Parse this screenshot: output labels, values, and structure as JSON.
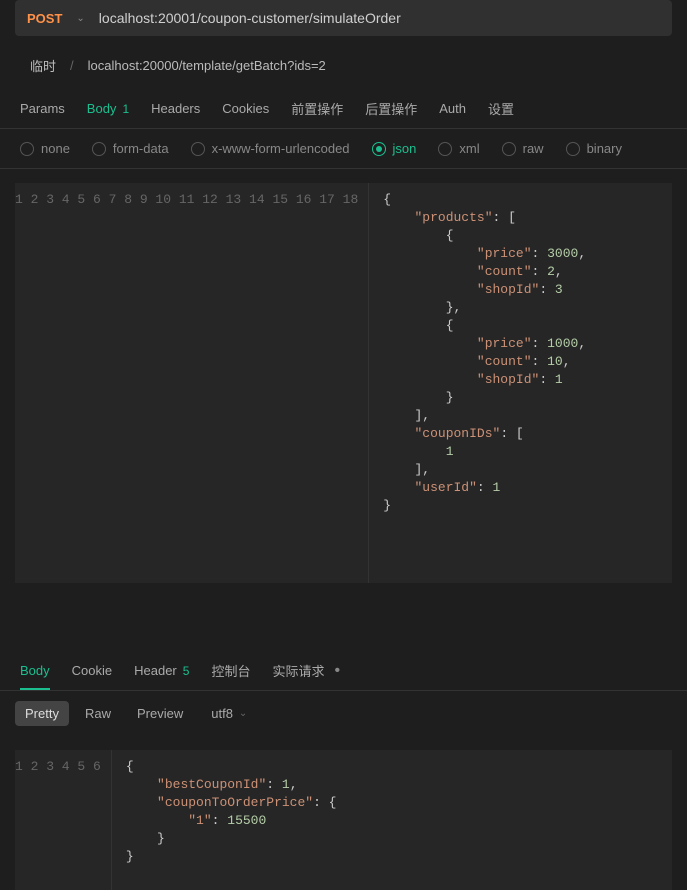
{
  "url_bar": {
    "method": "POST",
    "url": "localhost:20001/coupon-customer/simulateOrder"
  },
  "breadcrumb": {
    "folder": "临时",
    "path": "localhost:20000/template/getBatch?ids=2"
  },
  "request_tabs": {
    "params": "Params",
    "body": "Body",
    "body_count": "1",
    "headers": "Headers",
    "cookies": "Cookies",
    "pre": "前置操作",
    "post": "后置操作",
    "auth": "Auth",
    "settings": "设置"
  },
  "body_types": {
    "none": "none",
    "form_data": "form-data",
    "urlencoded": "x-www-form-urlencoded",
    "json": "json",
    "xml": "xml",
    "raw": "raw",
    "binary": "binary"
  },
  "request_code": {
    "line_count": 18,
    "html": "<span class='p'>{</span>\n    <span class='k'>\"products\"</span><span class='p'>: [</span>\n        <span class='p'>{</span>\n            <span class='k'>\"price\"</span><span class='p'>: </span><span class='n'>3000</span><span class='p'>,</span>\n            <span class='k'>\"count\"</span><span class='p'>: </span><span class='n'>2</span><span class='p'>,</span>\n            <span class='k'>\"shopId\"</span><span class='p'>: </span><span class='n'>3</span>\n        <span class='p'>},</span>\n        <span class='p'>{</span>\n            <span class='k'>\"price\"</span><span class='p'>: </span><span class='n'>1000</span><span class='p'>,</span>\n            <span class='k'>\"count\"</span><span class='p'>: </span><span class='n'>10</span><span class='p'>,</span>\n            <span class='k'>\"shopId\"</span><span class='p'>: </span><span class='n'>1</span>\n        <span class='p'>}</span>\n    <span class='p'>],</span>\n    <span class='k'>\"couponIDs\"</span><span class='p'>: [</span>\n        <span class='n'>1</span>\n    <span class='p'>],</span>\n    <span class='k'>\"userId\"</span><span class='p'>: </span><span class='n'>1</span>\n<span class='p'>}</span>"
  },
  "response_tabs": {
    "body": "Body",
    "cookie": "Cookie",
    "header": "Header",
    "header_count": "5",
    "console": "控制台",
    "actual": "实际请求"
  },
  "res_toolbar": {
    "pretty": "Pretty",
    "raw": "Raw",
    "preview": "Preview",
    "encoding": "utf8"
  },
  "response_code": {
    "line_count": 6,
    "html": "<span class='p'>{</span>\n    <span class='k'>\"bestCouponId\"</span><span class='p'>: </span><span class='n'>1</span><span class='p'>,</span>\n    <span class='k'>\"couponToOrderPrice\"</span><span class='p'>: {</span>\n        <span class='k'>\"1\"</span><span class='p'>: </span><span class='n'>15500</span>\n    <span class='p'>}</span>\n<span class='p'>}</span>"
  }
}
